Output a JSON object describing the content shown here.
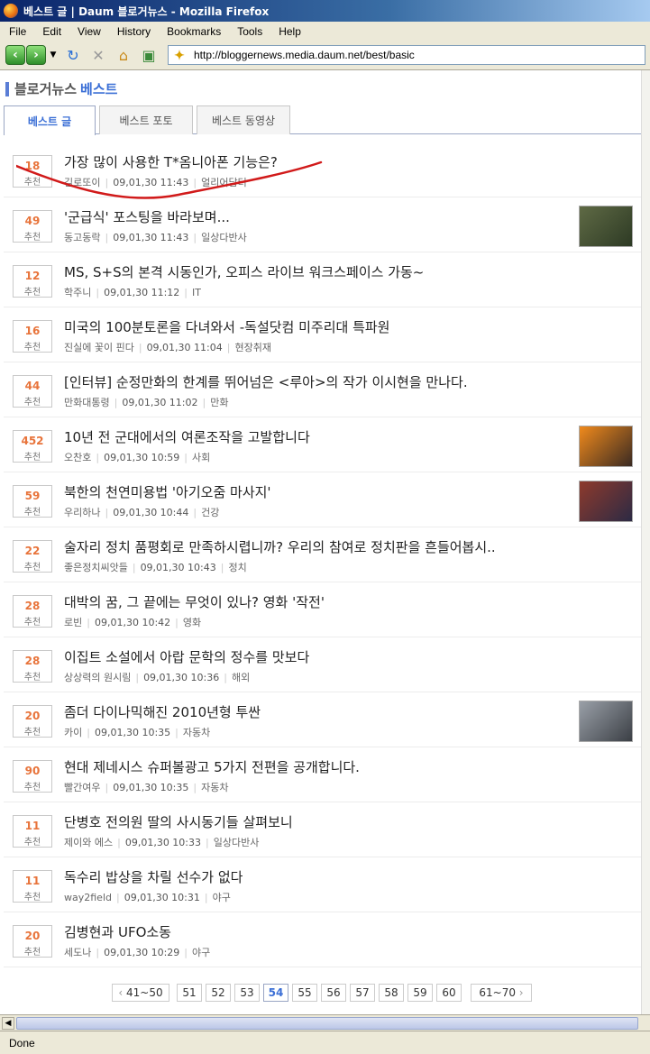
{
  "window": {
    "title": "베스트 글 | Daum 블로거뉴스 - Mozilla Firefox",
    "menu": [
      "File",
      "Edit",
      "View",
      "History",
      "Bookmarks",
      "Tools",
      "Help"
    ],
    "url": "http://bloggernews.media.daum.net/best/basic",
    "status": "Done"
  },
  "header": {
    "brand_main": "블로거뉴스",
    "brand_sub": "베스트"
  },
  "tabs": [
    {
      "label": "베스트 글",
      "active": true
    },
    {
      "label": "베스트 포토",
      "active": false
    },
    {
      "label": "베스트 동영상",
      "active": false
    }
  ],
  "vote_label": "추천",
  "articles": [
    {
      "votes": "18",
      "title": "가장 많이 사용한 T*옴니아폰 기능은?",
      "author": "김로또이",
      "date": "09,01,30 11:43",
      "category": "얼리어답터",
      "thumb": false
    },
    {
      "votes": "49",
      "title": "'군급식' 포스팅을 바라보며...",
      "author": "동고동락",
      "date": "09,01,30 11:43",
      "category": "일상다반사",
      "thumb": true,
      "thumb_colors": [
        "#5f6a45",
        "#2d3a24"
      ]
    },
    {
      "votes": "12",
      "title": "MS, S+S의 본격 시동인가, 오피스 라이브 워크스페이스 가동~",
      "author": "학주니",
      "date": "09,01,30 11:12",
      "category": "IT",
      "thumb": false
    },
    {
      "votes": "16",
      "title": "미국의 100분토론을 다녀와서 -독설닷컴 미주리대 특파원",
      "author": "진실에 꽃이 핀다",
      "date": "09,01,30 11:04",
      "category": "현장취재",
      "thumb": false
    },
    {
      "votes": "44",
      "title": "[인터뷰] 순정만화의 한계를 뛰어넘은 <루아>의 작가 이시현을 만나다.",
      "author": "만화대통령",
      "date": "09,01,30 11:02",
      "category": "만화",
      "thumb": false
    },
    {
      "votes": "452",
      "title": "10년 전 군대에서의 여론조작을 고발합니다",
      "author": "오찬호",
      "date": "09,01,30 10:59",
      "category": "사회",
      "thumb": true,
      "thumb_colors": [
        "#f08a1c",
        "#3a2a22"
      ]
    },
    {
      "votes": "59",
      "title": "북한의 천연미용법 '아기오줌 마사지'",
      "author": "우리하나",
      "date": "09,01,30 10:44",
      "category": "건강",
      "thumb": true,
      "thumb_colors": [
        "#8e3a2c",
        "#2c2a44"
      ]
    },
    {
      "votes": "22",
      "title": "술자리 정치 품평회로 만족하시렵니까? 우리의 참여로 정치판을 흔들어봅시..",
      "author": "좋은정치씨앗들",
      "date": "09,01,30 10:43",
      "category": "정치",
      "thumb": false
    },
    {
      "votes": "28",
      "title": "대박의 꿈, 그 끝에는 무엇이 있나? 영화 '작전'",
      "author": "로빈",
      "date": "09,01,30 10:42",
      "category": "영화",
      "thumb": false
    },
    {
      "votes": "28",
      "title": "이집트 소설에서 아랍 문학의 정수를 맛보다",
      "author": "상상력의 원시림",
      "date": "09,01,30 10:36",
      "category": "해외",
      "thumb": false
    },
    {
      "votes": "20",
      "title": "좀더 다이나믹해진 2010년형 투싼",
      "author": "카이",
      "date": "09,01,30 10:35",
      "category": "자동차",
      "thumb": true,
      "thumb_colors": [
        "#9aa0a8",
        "#3b3f45"
      ]
    },
    {
      "votes": "90",
      "title": "현대 제네시스 슈퍼볼광고 5가지 전편을 공개합니다.",
      "author": "빨간여우",
      "date": "09,01,30 10:35",
      "category": "자동차",
      "thumb": false
    },
    {
      "votes": "11",
      "title": "단병호 전의원 딸의 사시동기들 살펴보니",
      "author": "제이와 에스",
      "date": "09,01,30 10:33",
      "category": "일상다반사",
      "thumb": false
    },
    {
      "votes": "11",
      "title": "독수리 밥상을 차릴 선수가 없다",
      "author": "way2field",
      "date": "09,01,30 10:31",
      "category": "야구",
      "thumb": false
    },
    {
      "votes": "20",
      "title": "김병현과 UFO소동",
      "author": "세도나",
      "date": "09,01,30 10:29",
      "category": "야구",
      "thumb": false
    }
  ],
  "pager": {
    "prev": "41~50",
    "pages": [
      "51",
      "52",
      "53",
      "54",
      "55",
      "56",
      "57",
      "58",
      "59",
      "60"
    ],
    "current": "54",
    "next": "61~70"
  },
  "annotation_color": "#d11a1a"
}
